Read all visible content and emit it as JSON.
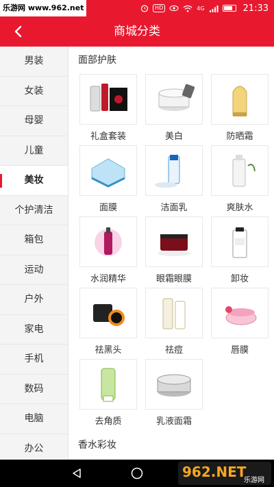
{
  "status_bar": {
    "watermark": "乐游网 www.962.net",
    "time": "21:33",
    "hd": "HD",
    "network": "4G"
  },
  "header": {
    "title": "商城分类",
    "back": "back-arrow"
  },
  "sidebar": {
    "items": [
      {
        "label": "男装",
        "active": false
      },
      {
        "label": "女装",
        "active": false
      },
      {
        "label": "母婴",
        "active": false
      },
      {
        "label": "儿童",
        "active": false
      },
      {
        "label": "美妆",
        "active": true
      },
      {
        "label": "个护清洁",
        "active": false
      },
      {
        "label": "箱包",
        "active": false
      },
      {
        "label": "运动",
        "active": false
      },
      {
        "label": "户外",
        "active": false
      },
      {
        "label": "家电",
        "active": false
      },
      {
        "label": "手机",
        "active": false
      },
      {
        "label": "数码",
        "active": false
      },
      {
        "label": "电脑",
        "active": false
      },
      {
        "label": "办公",
        "active": false
      }
    ]
  },
  "main": {
    "section1_title": "面部护肤",
    "products": [
      {
        "label": "礼盒套装",
        "icon": "gift-set-icon"
      },
      {
        "label": "美白",
        "icon": "whitening-cream-icon"
      },
      {
        "label": "防晒霜",
        "icon": "sunscreen-icon"
      },
      {
        "label": "面膜",
        "icon": "face-mask-icon"
      },
      {
        "label": "洁面乳",
        "icon": "cleanser-icon"
      },
      {
        "label": "爽肤水",
        "icon": "toner-icon"
      },
      {
        "label": "水润精华",
        "icon": "essence-icon"
      },
      {
        "label": "眼霜眼膜",
        "icon": "eye-cream-icon"
      },
      {
        "label": "卸妆",
        "icon": "makeup-remover-icon"
      },
      {
        "label": "祛黑头",
        "icon": "blackhead-remover-icon"
      },
      {
        "label": "祛痘",
        "icon": "acne-treatment-icon"
      },
      {
        "label": "唇膜",
        "icon": "lip-mask-icon"
      },
      {
        "label": "去角质",
        "icon": "exfoliator-icon"
      },
      {
        "label": "乳液面霜",
        "icon": "lotion-cream-icon"
      }
    ],
    "section2_title": "香水彩妆"
  },
  "nav_bar": {
    "back": "triangle-back",
    "home": "circle-home",
    "logo": "962.NET",
    "logo_sub": "乐游网"
  },
  "colors": {
    "brand_red": "#e8192f",
    "sidebar_bg": "#f4f4f4",
    "nav_black": "#000000"
  }
}
